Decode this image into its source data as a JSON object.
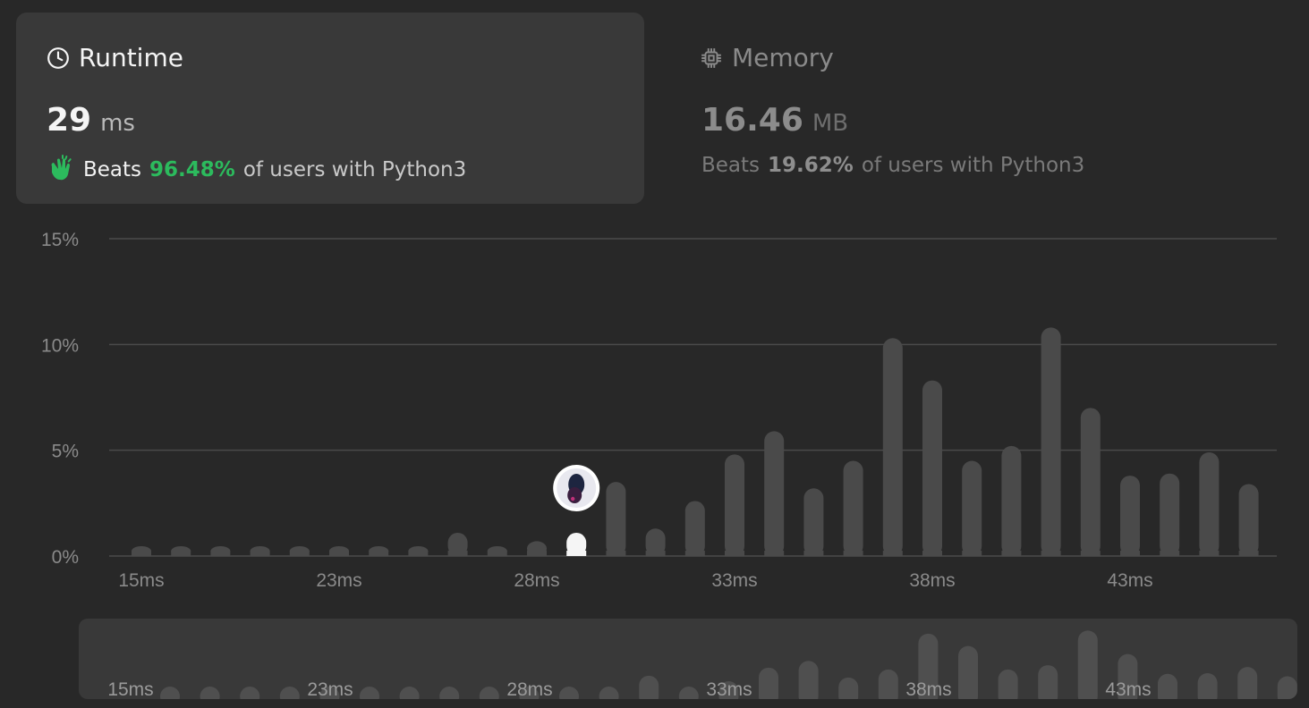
{
  "runtime": {
    "title": "Runtime",
    "value": "29",
    "unit": "ms",
    "beats_label": "Beats",
    "beats_pct": "96.48%",
    "beats_suffix": "of users with Python3",
    "icon": "clock-icon",
    "accent": "#2cbb5d"
  },
  "memory": {
    "title": "Memory",
    "value": "16.46",
    "unit": "MB",
    "beats_label": "Beats",
    "beats_pct": "19.62%",
    "beats_suffix": "of users with Python3",
    "icon": "chip-icon"
  },
  "chart_data": {
    "type": "bar",
    "y_ticks": [
      "15%",
      "10%",
      "5%",
      "0%"
    ],
    "ylim": [
      0,
      15
    ],
    "x_tick_labels": [
      "15ms",
      "23ms",
      "28ms",
      "33ms",
      "38ms",
      "43ms"
    ],
    "x_tick_positions": [
      0,
      5,
      10,
      15,
      20,
      25
    ],
    "values": [
      0.3,
      0.3,
      0.3,
      0.3,
      0.3,
      0.3,
      0.3,
      0.3,
      1.1,
      0.3,
      0.7,
      1.1,
      3.5,
      1.3,
      2.6,
      4.8,
      5.9,
      3.2,
      4.5,
      10.3,
      8.3,
      4.5,
      5.2,
      10.8,
      7.0,
      3.8,
      3.9,
      4.9,
      3.4
    ],
    "highlight_index": 11,
    "bar_color": "#4a4a4a",
    "highlight_color": "#f5f5f5",
    "marker": "user-avatar"
  },
  "mini_chart": {
    "x_tick_labels": [
      "15ms",
      "23ms",
      "28ms",
      "33ms",
      "38ms",
      "43ms"
    ]
  }
}
